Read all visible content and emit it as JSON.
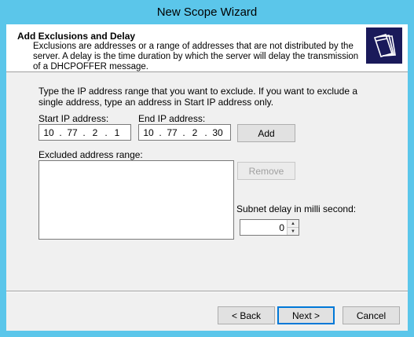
{
  "window": {
    "title": "New Scope Wizard"
  },
  "header": {
    "title": "Add Exclusions and Delay",
    "description": "Exclusions are addresses or a range of addresses that are not distributed by the server. A delay is the time duration by which the server will delay the transmission of a DHCPOFFER message."
  },
  "form": {
    "instructions": "Type the IP address range that you want to exclude. If you want to exclude a single address, type an address in Start IP address only.",
    "start_ip_label": "Start IP address:",
    "start_ip": [
      "10",
      "77",
      "2",
      "1"
    ],
    "end_ip_label": "End IP address:",
    "end_ip": [
      "10",
      "77",
      "2",
      "30"
    ],
    "add_label": "Add",
    "excluded_label": "Excluded address range:",
    "remove_label": "Remove",
    "subnet_delay_label": "Subnet delay in milli second:",
    "subnet_delay_value": "0"
  },
  "footer": {
    "back_label": "< Back",
    "next_label": "Next >",
    "cancel_label": "Cancel"
  },
  "colors": {
    "title_bar": "#5bc6ea",
    "default_button_border": "#0078d7"
  },
  "icons": {
    "header": "folders-icon"
  }
}
